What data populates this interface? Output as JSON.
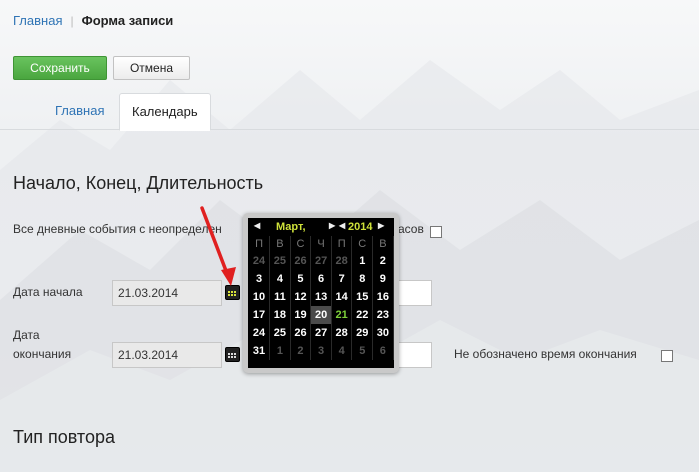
{
  "breadcrumb": {
    "home": "Главная",
    "current": "Форма записи"
  },
  "toolbar": {
    "save_label": "Сохранить",
    "cancel_label": "Отмена"
  },
  "tabs": [
    {
      "label": "Главная"
    },
    {
      "label": "Календарь"
    }
  ],
  "section1": {
    "title": "Начало, Конец, Длительность",
    "allday_label": "Все дневные события с неопределен",
    "allday_label_tail": "асов",
    "start_label": "Дата начала",
    "start_value": "21.03.2014",
    "end_label_line1": "Дата",
    "end_label_line2": "окончания",
    "end_value": "21.03.2014",
    "no_end_time_label": "Не обозначено время окончания"
  },
  "section2": {
    "title": "Тип повтора"
  },
  "datepicker": {
    "month": "Март,",
    "year": "2014",
    "weekdays": [
      "П",
      "В",
      "С",
      "Ч",
      "П",
      "С",
      "В"
    ],
    "weeks": [
      [
        "24",
        "25",
        "26",
        "27",
        "28",
        "1",
        "2"
      ],
      [
        "3",
        "4",
        "5",
        "6",
        "7",
        "8",
        "9"
      ],
      [
        "10",
        "11",
        "12",
        "13",
        "14",
        "15",
        "16"
      ],
      [
        "17",
        "18",
        "19",
        "20",
        "21",
        "22",
        "23"
      ],
      [
        "24",
        "25",
        "26",
        "27",
        "28",
        "29",
        "30"
      ],
      [
        "31",
        "1",
        "2",
        "3",
        "4",
        "5",
        "6"
      ]
    ],
    "today": "20",
    "selected": "21"
  },
  "icons": {
    "calendar": "calendar-icon",
    "arrow_left": "arrow-left-icon",
    "arrow_right": "arrow-right-icon"
  },
  "colors": {
    "save": "#4aa63f",
    "link": "#2f74b5",
    "picker_accent": "#cfe23a",
    "selected_day": "#7ed13a",
    "annotation_arrow": "#e02020"
  }
}
